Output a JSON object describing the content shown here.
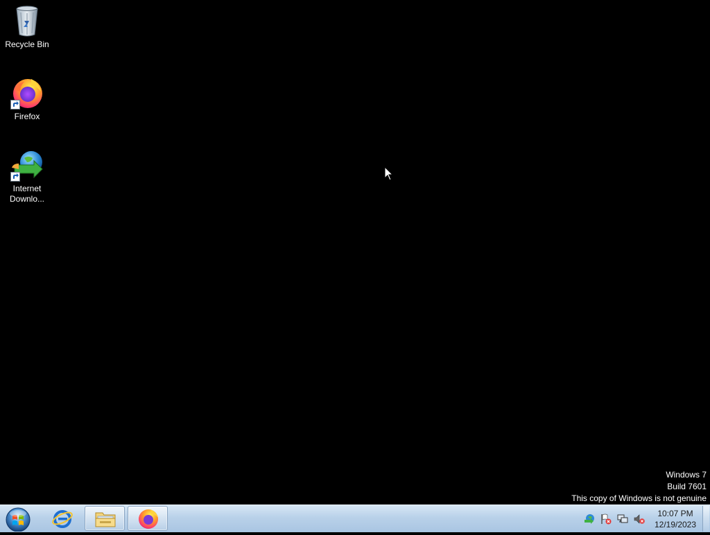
{
  "desktop": {
    "background_color": "#000000",
    "icons": [
      {
        "label": "Recycle Bin",
        "icon": "recycle-bin-icon"
      },
      {
        "label": "Firefox",
        "icon": "firefox-icon"
      },
      {
        "label": "Internet\nDownlo...",
        "icon": "internet-download-manager-icon"
      }
    ]
  },
  "watermark": {
    "line1": "Windows 7",
    "line2": "Build 7601",
    "line3": "This copy of Windows is not genuine"
  },
  "taskbar": {
    "start_icon": "windows-start-orb-icon",
    "pinned": [
      {
        "icon": "internet-explorer-icon",
        "open": false
      },
      {
        "icon": "windows-explorer-folder-icon",
        "open": true
      },
      {
        "icon": "firefox-icon",
        "open": true
      }
    ],
    "tray_icons": [
      "network-globe-icon",
      "action-center-flag-icon",
      "network-status-icon",
      "volume-muted-icon"
    ],
    "clock": {
      "time": "10:07 PM",
      "date": "12/19/2023"
    }
  }
}
